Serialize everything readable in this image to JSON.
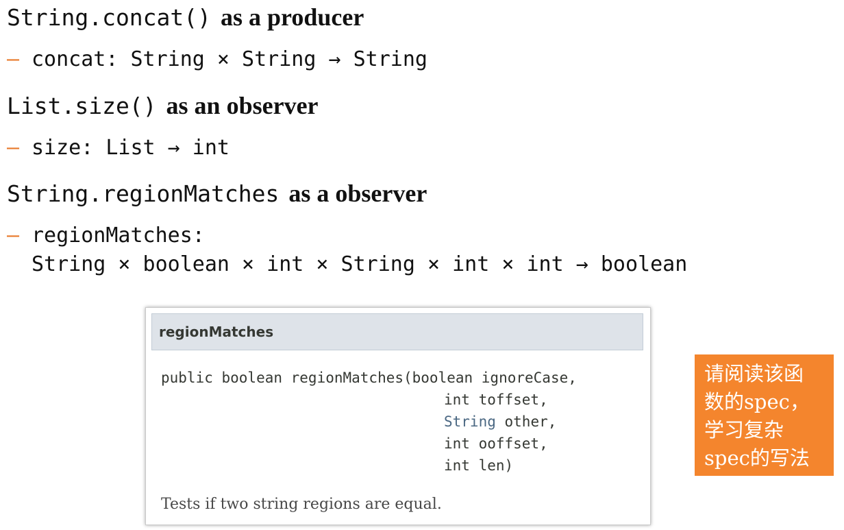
{
  "items": [
    {
      "code": "String.concat()",
      "desc": "as a producer",
      "bullet": "concat: String × String → String"
    },
    {
      "code": "List.size()",
      "desc": "as an observer",
      "bullet": "size: List → int"
    },
    {
      "code": "String.regionMatches",
      "desc": "as a observer",
      "bullet": "regionMatches:",
      "bullet_cont": "String × boolean × int × String × int × int → boolean"
    }
  ],
  "doc": {
    "title": "regionMatches",
    "sig_lines": [
      "public boolean regionMatches(boolean ignoreCase,",
      "int toffset,",
      "String",
      "other,",
      "int ooffset,",
      "int len)"
    ],
    "description": "Tests if two string regions are equal."
  },
  "note": {
    "lines": [
      "请阅读该函",
      "数的spec，",
      "学习复杂",
      "spec的写法"
    ],
    "color": "#f4852d"
  },
  "colors": {
    "dash": "#e8792a",
    "doc_header_bg": "#dee3e9",
    "type_link": "#4a6782"
  }
}
